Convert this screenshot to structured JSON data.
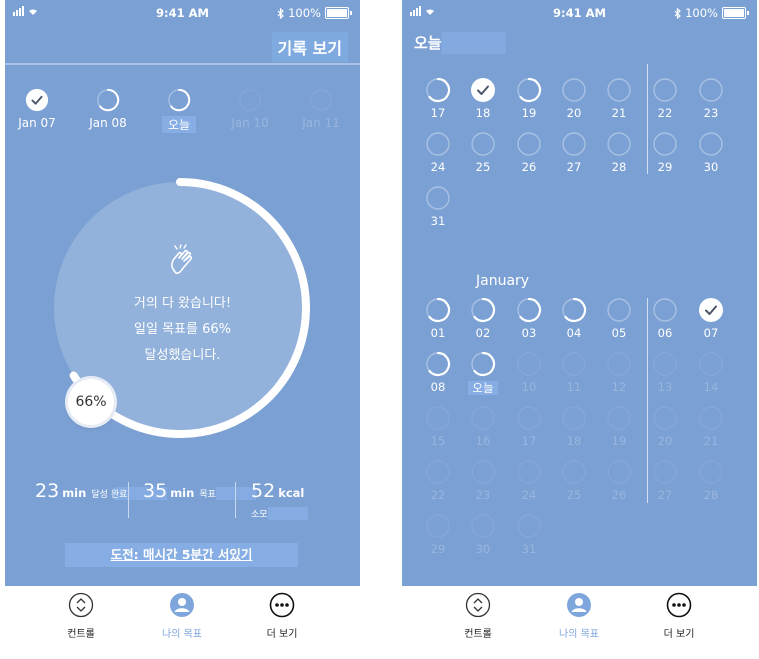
{
  "status": {
    "time": "9:41 AM",
    "battery": "100%"
  },
  "screen1": {
    "record_button": "기록 보기",
    "days": [
      {
        "label": "Jan 07",
        "state": "done"
      },
      {
        "label": "Jan 08",
        "state": "partial"
      },
      {
        "label": "오늘",
        "state": "partial"
      },
      {
        "label": "Jan 10",
        "state": "future"
      },
      {
        "label": "Jan 11",
        "state": "future"
      }
    ],
    "message": [
      "거의 다 왔습니다!",
      "일일 목표를 66%",
      "달성했습니다."
    ],
    "progress_percent": 66,
    "progress_label": "66%",
    "stats": [
      {
        "value": "23",
        "unit": "min",
        "label": "달성 완료"
      },
      {
        "value": "35",
        "unit": "min",
        "label": "목표"
      },
      {
        "value": "52",
        "unit": "kcal",
        "label": "소모"
      }
    ],
    "challenge": "도전: 매시간 5분간 서있기"
  },
  "screen2": {
    "title": "오늘",
    "prev_month": [
      {
        "day": "17",
        "state": "partial"
      },
      {
        "day": "18",
        "state": "done"
      },
      {
        "day": "19",
        "state": "partial"
      },
      {
        "day": "20",
        "state": "empty"
      },
      {
        "day": "21",
        "state": "empty"
      },
      {
        "day": "22",
        "state": "empty"
      },
      {
        "day": "23",
        "state": "empty"
      },
      {
        "day": "24",
        "state": "empty"
      },
      {
        "day": "25",
        "state": "empty"
      },
      {
        "day": "26",
        "state": "empty"
      },
      {
        "day": "27",
        "state": "empty"
      },
      {
        "day": "28",
        "state": "empty"
      },
      {
        "day": "29",
        "state": "empty"
      },
      {
        "day": "30",
        "state": "empty"
      },
      {
        "day": "31",
        "state": "empty"
      }
    ],
    "month_label": "January",
    "month": [
      {
        "day": "01",
        "state": "partial"
      },
      {
        "day": "02",
        "state": "partial"
      },
      {
        "day": "03",
        "state": "partial"
      },
      {
        "day": "04",
        "state": "partial"
      },
      {
        "day": "05",
        "state": "empty"
      },
      {
        "day": "06",
        "state": "empty"
      },
      {
        "day": "07",
        "state": "done"
      },
      {
        "day": "08",
        "state": "partial"
      },
      {
        "day": "오늘",
        "state": "partial",
        "today": true
      },
      {
        "day": "10",
        "state": "future"
      },
      {
        "day": "11",
        "state": "future"
      },
      {
        "day": "12",
        "state": "future"
      },
      {
        "day": "13",
        "state": "future"
      },
      {
        "day": "14",
        "state": "future"
      },
      {
        "day": "15",
        "state": "future"
      },
      {
        "day": "16",
        "state": "future"
      },
      {
        "day": "17",
        "state": "future"
      },
      {
        "day": "18",
        "state": "future"
      },
      {
        "day": "19",
        "state": "future"
      },
      {
        "day": "20",
        "state": "future"
      },
      {
        "day": "21",
        "state": "future"
      },
      {
        "day": "22",
        "state": "future"
      },
      {
        "day": "23",
        "state": "future"
      },
      {
        "day": "24",
        "state": "future"
      },
      {
        "day": "25",
        "state": "future"
      },
      {
        "day": "26",
        "state": "future"
      },
      {
        "day": "27",
        "state": "future"
      },
      {
        "day": "28",
        "state": "future"
      },
      {
        "day": "29",
        "state": "future"
      },
      {
        "day": "30",
        "state": "future"
      },
      {
        "day": "31",
        "state": "future"
      }
    ]
  },
  "tabs": [
    {
      "label": "컨트롤",
      "icon": "chevron-up-down-icon"
    },
    {
      "label": "나의 목표",
      "icon": "user-icon",
      "active": true
    },
    {
      "label": "더 보기",
      "icon": "more-icon"
    }
  ],
  "colors": {
    "background": "#7ba0d4",
    "accent": "#7ea6dc",
    "ring": "#ffffff"
  }
}
